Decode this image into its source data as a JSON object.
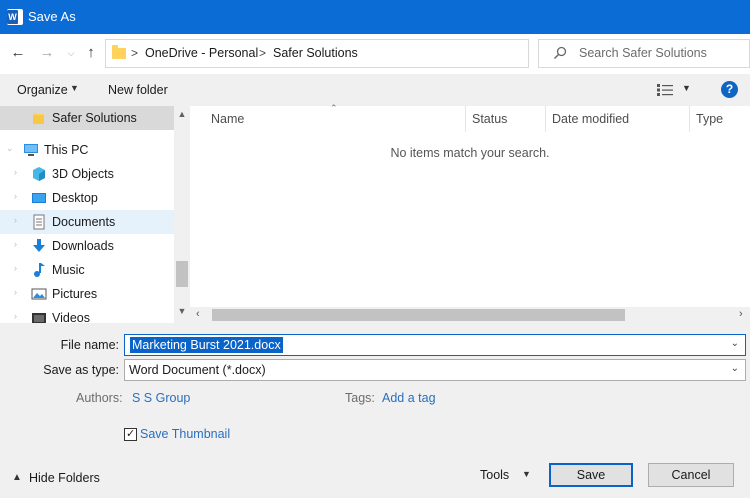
{
  "window": {
    "title": "Save As",
    "app_badge": "W"
  },
  "address": {
    "path": [
      "OneDrive - Personal",
      "Safer Solutions"
    ],
    "separator": ">",
    "search_placeholder": "Search Safer Solutions"
  },
  "toolbar": {
    "organize": "Organize",
    "new_folder": "New folder",
    "help": "?"
  },
  "nav": {
    "items": [
      {
        "label": "Safer Solutions",
        "icon": "folder-icon"
      },
      {
        "label": "This PC",
        "icon": "pc-icon"
      },
      {
        "label": "3D Objects",
        "icon": "3d-objects-icon"
      },
      {
        "label": "Desktop",
        "icon": "desktop-icon"
      },
      {
        "label": "Documents",
        "icon": "documents-icon"
      },
      {
        "label": "Downloads",
        "icon": "downloads-icon"
      },
      {
        "label": "Music",
        "icon": "music-icon"
      },
      {
        "label": "Pictures",
        "icon": "pictures-icon"
      },
      {
        "label": "Videos",
        "icon": "videos-icon"
      }
    ]
  },
  "file_list": {
    "columns": [
      "Name",
      "Status",
      "Date modified",
      "Type"
    ],
    "empty_message": "No items match your search."
  },
  "form": {
    "file_name_label": "File name:",
    "file_name_value": "Marketing Burst 2021.docx",
    "save_type_label": "Save as type:",
    "save_type_value": "Word Document (*.docx)",
    "authors_label": "Authors:",
    "authors_value": "S S Group",
    "tags_label": "Tags:",
    "tags_value": "Add a tag",
    "save_thumbnail_label": "Save Thumbnail",
    "save_thumbnail_checked": true
  },
  "footer": {
    "hide_folders": "Hide Folders",
    "tools": "Tools",
    "save": "Save",
    "cancel": "Cancel"
  },
  "colors": {
    "titlebar": "#0b6cd6",
    "accent": "#0a63c9",
    "link": "#2a6fbf"
  }
}
